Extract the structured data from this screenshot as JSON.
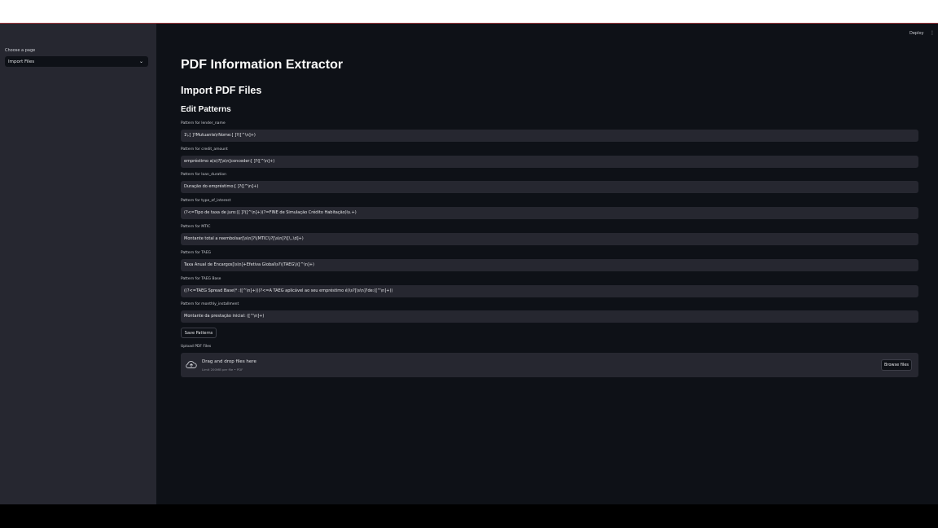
{
  "header": {
    "deploy_label": "Deploy",
    "menu_glyph": "⋮"
  },
  "sidebar": {
    "label": "Choose a page",
    "select": {
      "value": "Import Files",
      "chevron": "⌄"
    }
  },
  "main": {
    "title": "PDF Information Extractor",
    "subtitle": "Import PDF Files",
    "section": "Edit Patterns",
    "fields": [
      {
        "label": "Pattern for lender_name",
        "value": "1\\.[ ]?Mutuante\\rNome:[ ]?([^\\n]+)"
      },
      {
        "label": "Pattern for credit_amount",
        "value": "empréstimo a(o)?[\\s\\n]conceder:[ ]?([^\\n]+)"
      },
      {
        "label": "Pattern for loan_duration",
        "value": "Duração do empréstimo:[ ]?([^\\n]+)"
      },
      {
        "label": "Pattern for type_of_interest",
        "value": "(?<=Tipo de taxa de juro:)[ ]?([^\\n]+)(?=FINE de Simulação Crédito Habitação)\\s.+)"
      },
      {
        "label": "Pattern for MTIC",
        "value": "Montante total a reembolsar[\\s\\n]?\\(MTIC\\)?[\\s\\n]?([\\.,\\d]+)"
      },
      {
        "label": "Pattern for TAEG",
        "value": "Taxa Anual de Encargos[\\s\\n]+Efetiva Global\\s?\\(TAEG\\)([^\\n]+)"
      },
      {
        "label": "Pattern for TAEG Base",
        "value": "((?<=TAEG Spread Base\\* :)[^\\n]+)((?<=A TAEG aplicável ao seu empréstimo é)\\s?[\\s\\n]?de:([^\\n]+))"
      },
      {
        "label": "Pattern for monthly_installment",
        "value": "Montante da prestação inicial: ([^\\n]+)"
      }
    ],
    "save_label": "Save Patterns",
    "upload": {
      "label": "Upload PDF Files",
      "drag_text": "Drag and drop files here",
      "limit_text": "Limit 200MB per file • PDF",
      "browse_label": "Browse files"
    }
  },
  "colors": {
    "app_bg": "#0e1117",
    "sidebar_bg": "#262730",
    "input_bg": "#262730",
    "text": "#fafafa",
    "top_accent": "#a23a3f"
  }
}
